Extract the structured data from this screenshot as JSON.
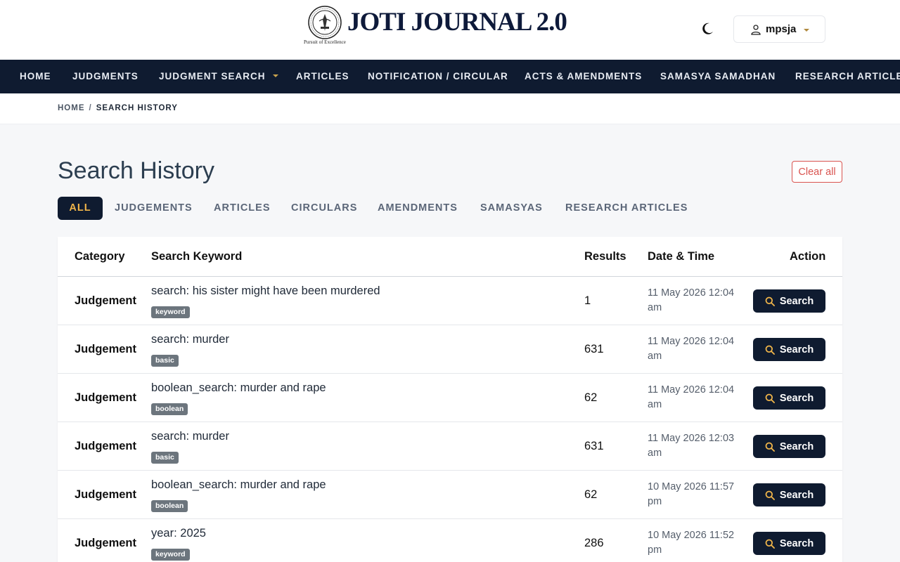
{
  "header": {
    "title": "JOTI JOURNAL 2.0",
    "motto": "Pursuit of Excellence",
    "user": "mpsja"
  },
  "nav": [
    {
      "label": "HOME"
    },
    {
      "label": "JUDGMENTS"
    },
    {
      "label": "JUDGMENT SEARCH",
      "dropdown": true
    },
    {
      "label": "ARTICLES"
    },
    {
      "label": "NOTIFICATION / CIRCULAR"
    },
    {
      "label": "ACTS & AMENDMENTS"
    },
    {
      "label": "SAMASYA SAMADHAN"
    },
    {
      "label": "RESEARCH ARTICLES"
    }
  ],
  "breadcrumb": {
    "home": "HOME",
    "sep": "/",
    "current": "SEARCH HISTORY"
  },
  "page": {
    "title": "Search History",
    "clear_label": "Clear all"
  },
  "tabs": [
    {
      "label": "ALL",
      "active": true
    },
    {
      "label": "JUDGEMENTS"
    },
    {
      "label": "ARTICLES"
    },
    {
      "label": "CIRCULARS"
    },
    {
      "label": "AMENDMENTS"
    },
    {
      "label": "SAMASYAS"
    },
    {
      "label": "RESEARCH ARTICLES"
    }
  ],
  "table": {
    "headers": {
      "category": "Category",
      "keyword": "Search Keyword",
      "results": "Results",
      "datetime": "Date & Time",
      "action": "Action"
    },
    "rows": [
      {
        "category": "Judgement",
        "keyword": "search: his sister might have been murdered",
        "badge": "keyword",
        "results": "1",
        "date": "11 May 2026 12:04 am",
        "action": "Search"
      },
      {
        "category": "Judgement",
        "keyword": "search: murder",
        "badge": "basic",
        "results": "631",
        "date": "11 May 2026 12:04 am",
        "action": "Search"
      },
      {
        "category": "Judgement",
        "keyword": "boolean_search: murder and rape",
        "badge": "boolean",
        "results": "62",
        "date": "11 May 2026 12:04 am",
        "action": "Search"
      },
      {
        "category": "Judgement",
        "keyword": "search: murder",
        "badge": "basic",
        "results": "631",
        "date": "11 May 2026 12:03 am",
        "action": "Search"
      },
      {
        "category": "Judgement",
        "keyword": "boolean_search: murder and rape",
        "badge": "boolean",
        "results": "62",
        "date": "10 May 2026 11:57 pm",
        "action": "Search"
      },
      {
        "category": "Judgement",
        "keyword": "year: 2025",
        "badge": "keyword",
        "results": "286",
        "date": "10 May 2026 11:52 pm",
        "action": "Search"
      }
    ]
  },
  "colors": {
    "navy": "#0f1b30",
    "gold": "#f0b54a",
    "danger": "#d9534f",
    "badge": "#6c757d"
  }
}
